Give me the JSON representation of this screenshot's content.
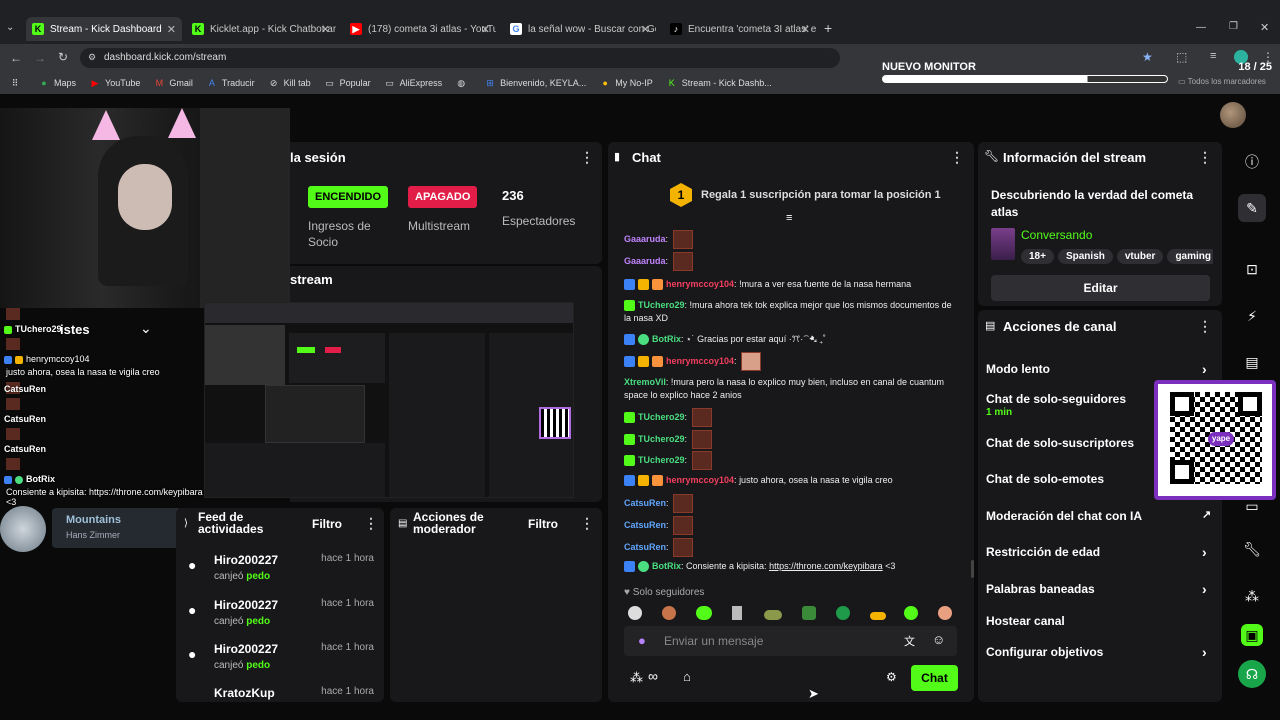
{
  "browser": {
    "tabs": [
      {
        "title": "Stream - Kick Dashboard",
        "active": true
      },
      {
        "title": "Kicklet.app - Kick Chatbot and"
      },
      {
        "title": "(178) cometa 3i atlas - YouTube"
      },
      {
        "title": "la señal wow - Buscar con Goo"
      },
      {
        "title": "Encuentra 'cometa 3I atlas' en T"
      }
    ],
    "new_tab": "+",
    "url": "dashboard.kick.com/stream",
    "bookmarks": [
      "Maps",
      "YouTube",
      "Gmail",
      "Traducir",
      "Kill tab",
      "Popular",
      "AliExpress",
      "",
      "Bienvenido, KEYLA...",
      "My No-IP",
      "Stream - Kick Dashb..."
    ],
    "all_bookmarks": "Todos los marcadores"
  },
  "monitor": {
    "title": "NUEVO MONITOR",
    "count": "18 / 25",
    "progress": 0.72
  },
  "overlay": {
    "lines": [
      {
        "name": "TUchero29",
        "text": ""
      },
      {
        "name": "henrymccoy104",
        "text": ""
      },
      {
        "name": "",
        "text": "justo ahora, osea la nasa te vigila creo"
      },
      {
        "name": "CatsuRen",
        "text": ""
      },
      {
        "name": "CatsuRen",
        "text": ""
      },
      {
        "name": "CatsuRen",
        "text": ""
      },
      {
        "name": "BotRix",
        "text": ""
      },
      {
        "name": "",
        "text": "Consiente a kipisita: https://throne.com/keypibara <3"
      }
    ],
    "partial_title": "istes",
    "music": {
      "title": "Mountains",
      "artist": "Hans Zimmer"
    }
  },
  "session": {
    "title": "la sesión",
    "status_on": "ENCENDIDO",
    "status_on_label": "Ingresos de Socio",
    "status_off": "APAGADO",
    "status_off_label": "Multistream",
    "viewers": "236",
    "viewers_label": "Espectadores",
    "stream_title": "stream"
  },
  "feed": {
    "title": "Feed de actividades",
    "filter": "Filtro",
    "items": [
      {
        "user": "Hiro200227",
        "time": "hace 1 hora",
        "action": "canjeó",
        "item": "pedo"
      },
      {
        "user": "Hiro200227",
        "time": "hace 1 hora",
        "action": "canjeó",
        "item": "pedo"
      },
      {
        "user": "Hiro200227",
        "time": "hace 1 hora",
        "action": "canjeó",
        "item": "pedo"
      },
      {
        "user": "KratozKup",
        "time": "hace 1 hora",
        "action": "",
        "item": ""
      }
    ]
  },
  "modactions": {
    "title": "Acciones de moderador",
    "filter": "Filtro"
  },
  "chat": {
    "title": "Chat",
    "pinned_rank": "1",
    "pinned_text": "Regala 1 suscripción para tomar la posición 1",
    "messages": [
      {
        "user": "Gaaaruda",
        "color": "p",
        "text": "",
        "emote": true
      },
      {
        "user": "Gaaaruda",
        "color": "p",
        "text": "",
        "emote": true
      },
      {
        "user": "henrymccoy104",
        "color": "r",
        "text": "!mura a ver esa fuente de la nasa hermana"
      },
      {
        "user": "TUchero29",
        "color": "g",
        "text": "!mura ahora tek tok explica mejor que los mismos documentos de la nasa XD"
      },
      {
        "user": "BotRix",
        "color": "g",
        "text": "⋆˙ Gracias por estar aquí ·ꔫ·⁀➷ ₊˚"
      },
      {
        "user": "henrymccoy104",
        "color": "r",
        "text": "",
        "emote": true
      },
      {
        "user": "XtremoVil",
        "color": "g",
        "text": "!mura pero la nasa lo explico muy bien, incluso en canal de cuantum space lo explico hace 2 anios"
      },
      {
        "user": "TUchero29",
        "color": "g",
        "text": "",
        "emote": true
      },
      {
        "user": "TUchero29",
        "color": "g",
        "text": "",
        "emote": true
      },
      {
        "user": "TUchero29",
        "color": "g",
        "text": "",
        "emote": true
      },
      {
        "user": "henrymccoy104",
        "color": "r",
        "text": "justo ahora, osea la nasa te vigila creo"
      },
      {
        "user": "CatsuRen",
        "color": "b",
        "text": "",
        "emote": true
      },
      {
        "user": "CatsuRen",
        "color": "b",
        "text": "",
        "emote": true
      },
      {
        "user": "CatsuRen",
        "color": "b",
        "text": "",
        "emote": true
      },
      {
        "user": "BotRix",
        "color": "g",
        "text": "Consiente a kipisita: ",
        "link": "https://throne.com/keypibara",
        "after": " <3"
      }
    ],
    "followers_only": "Solo seguidores",
    "input_placeholder": "Enviar un mensaje",
    "send": "Chat"
  },
  "stream_info": {
    "title": "Información del stream",
    "stream_title": "Descubriendo la verdad del cometa atlas",
    "category": "Conversando",
    "tags": [
      "18+",
      "Spanish",
      "vtuber",
      "gaming"
    ],
    "edit": "Editar"
  },
  "channel_actions": {
    "title": "Acciones de canal",
    "items": [
      {
        "label": "Modo lento",
        "sub": ""
      },
      {
        "label": "Chat de solo-seguidores",
        "sub": "1 min"
      },
      {
        "label": "Chat de solo-suscriptores",
        "sub": ""
      },
      {
        "label": "Chat de solo-emotes",
        "sub": ""
      },
      {
        "label": "Moderación del chat con IA",
        "sub": ""
      },
      {
        "label": "Restricción de edad",
        "sub": ""
      },
      {
        "label": "Palabras baneadas",
        "sub": ""
      },
      {
        "label": "Hostear canal",
        "sub": ""
      },
      {
        "label": "Configurar objetivos",
        "sub": ""
      }
    ]
  },
  "qr": {
    "label": "yape"
  },
  "colors": {
    "kick_green": "#53fc18",
    "on": "#53fc18",
    "off": "#e11d48"
  }
}
